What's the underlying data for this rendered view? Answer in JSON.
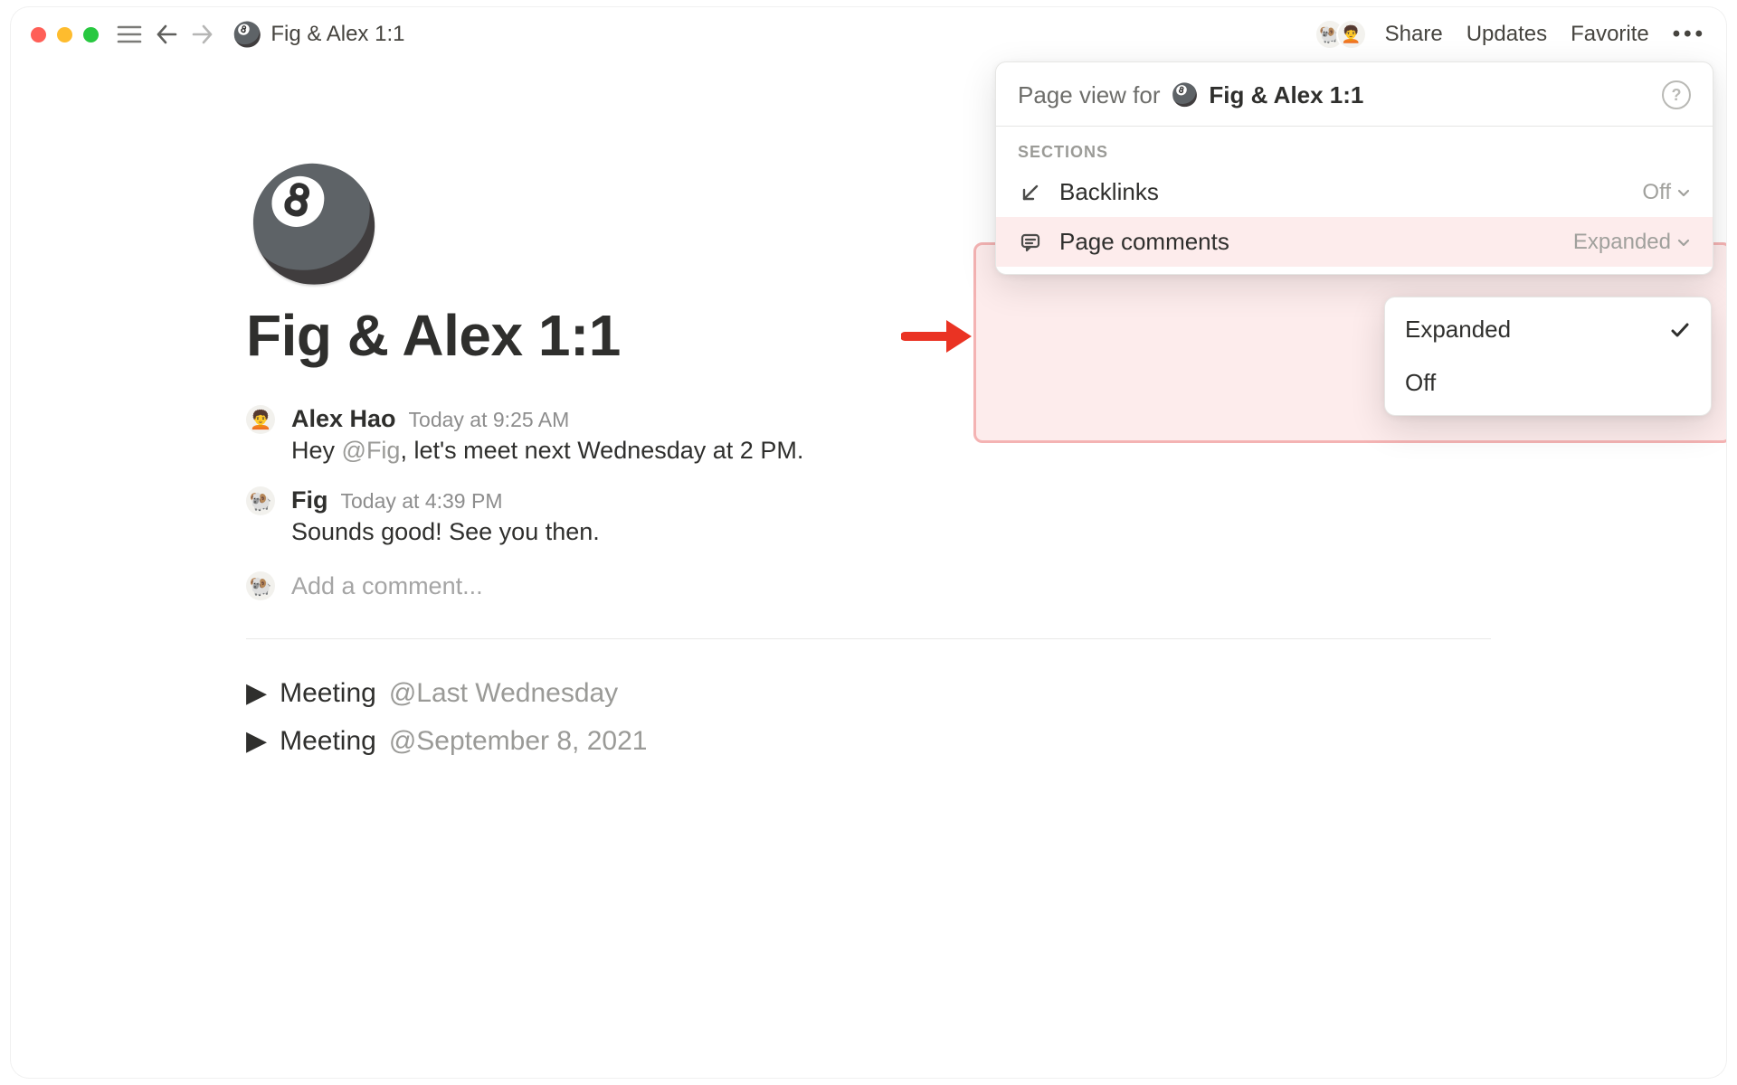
{
  "breadcrumb": {
    "icon": "🎱",
    "title": "Fig & Alex 1:1"
  },
  "topbar": {
    "share": "Share",
    "updates": "Updates",
    "favorite": "Favorite"
  },
  "page": {
    "icon": "🎱",
    "title": "Fig & Alex 1:1"
  },
  "comments": [
    {
      "avatar": "🧑‍🦱",
      "author": "Alex Hao",
      "time": "Today at 9:25 AM",
      "text_before": "Hey ",
      "mention": "@Fig",
      "text_after": ", let's meet next Wednesday at 2 PM."
    },
    {
      "avatar": "🐏",
      "author": "Fig",
      "time": "Today at 4:39 PM",
      "text_before": "Sounds good! See you then.",
      "mention": "",
      "text_after": ""
    }
  ],
  "add_comment": {
    "avatar": "🐏",
    "placeholder": "Add a comment..."
  },
  "toggles": [
    {
      "label": "Meeting",
      "date": "@Last Wednesday"
    },
    {
      "label": "Meeting",
      "date": "@September 8, 2021"
    }
  ],
  "menu": {
    "lead": "Page view for",
    "icon": "🎱",
    "title": "Fig & Alex 1:1",
    "section_label": "SECTIONS",
    "rows": {
      "backlinks": {
        "label": "Backlinks",
        "value": "Off"
      },
      "page_comments": {
        "label": "Page comments",
        "value": "Expanded"
      }
    }
  },
  "dropdown": {
    "options": [
      {
        "label": "Expanded",
        "selected": true
      },
      {
        "label": "Off",
        "selected": false
      }
    ]
  }
}
